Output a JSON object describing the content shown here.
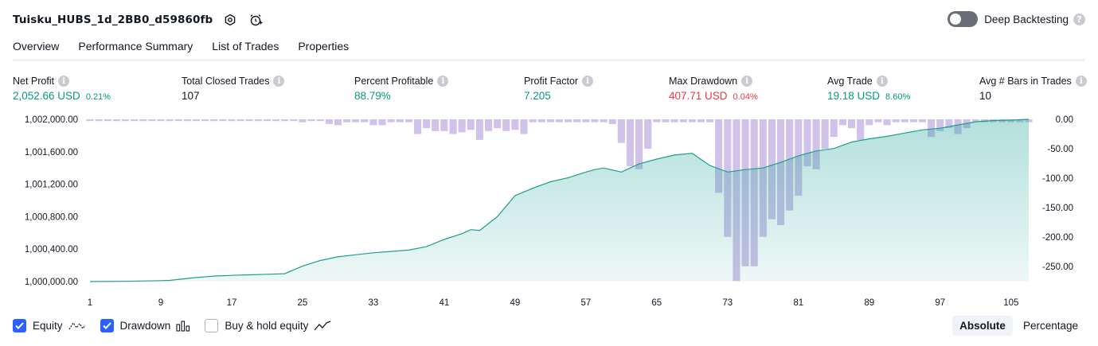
{
  "header": {
    "title": "Tuisku_HUBS_1d_2BB0_d59860fb",
    "deep_label": "Deep Backtesting",
    "deep_enabled": false
  },
  "tabs": [
    {
      "label": "Overview",
      "active": true
    },
    {
      "label": "Performance Summary",
      "active": false
    },
    {
      "label": "List of Trades",
      "active": false
    },
    {
      "label": "Properties",
      "active": false
    }
  ],
  "metrics": [
    {
      "label": "Net Profit",
      "value": "2,052.66 USD",
      "sub": "0.21%",
      "tone": "g"
    },
    {
      "label": "Total Closed Trades",
      "value": "107",
      "sub": "",
      "tone": "k"
    },
    {
      "label": "Percent Profitable",
      "value": "88.79%",
      "sub": "",
      "tone": "g"
    },
    {
      "label": "Profit Factor",
      "value": "7.205",
      "sub": "",
      "tone": "g"
    },
    {
      "label": "Max Drawdown",
      "value": "407.71 USD",
      "sub": "0.04%",
      "tone": "r"
    },
    {
      "label": "Avg Trade",
      "value": "19.18 USD",
      "sub": "8.60%",
      "tone": "g"
    },
    {
      "label": "Avg # Bars in Trades",
      "value": "10",
      "sub": "",
      "tone": "k"
    }
  ],
  "chart_data": {
    "type": "area",
    "x_ticks": [
      "1",
      "9",
      "17",
      "25",
      "33",
      "41",
      "49",
      "57",
      "65",
      "73",
      "81",
      "89",
      "97",
      "105"
    ],
    "left_axis": {
      "ticks": [
        "1,002,000.00",
        "1,001,600.00",
        "1,001,200.00",
        "1,000,800.00",
        "1,000,400.00",
        "1,000,000.00"
      ],
      "range": [
        1000000,
        1002000
      ]
    },
    "right_axis": {
      "ticks": [
        "0.00",
        "-50.00",
        "-100.00",
        "-150.00",
        "-200.00",
        "-250.00"
      ],
      "range": [
        -276,
        0
      ]
    },
    "series": [
      {
        "name": "Equity",
        "color": "#26a69a",
        "points": [
          [
            1,
            1000000
          ],
          [
            5,
            1000003
          ],
          [
            9,
            1000012
          ],
          [
            10,
            1000015
          ],
          [
            13,
            1000050
          ],
          [
            15,
            1000068
          ],
          [
            17,
            1000076
          ],
          [
            19,
            1000083
          ],
          [
            21,
            1000090
          ],
          [
            23,
            1000097
          ],
          [
            25,
            1000190
          ],
          [
            27,
            1000260
          ],
          [
            29,
            1000305
          ],
          [
            31,
            1000330
          ],
          [
            33,
            1000355
          ],
          [
            35,
            1000372
          ],
          [
            37,
            1000388
          ],
          [
            39,
            1000430
          ],
          [
            41,
            1000520
          ],
          [
            43,
            1000590
          ],
          [
            44,
            1000640
          ],
          [
            45,
            1000630
          ],
          [
            47,
            1000800
          ],
          [
            49,
            1001060
          ],
          [
            51,
            1001150
          ],
          [
            53,
            1001230
          ],
          [
            55,
            1001280
          ],
          [
            57,
            1001350
          ],
          [
            58,
            1001380
          ],
          [
            59,
            1001400
          ],
          [
            61,
            1001350
          ],
          [
            63,
            1001450
          ],
          [
            65,
            1001510
          ],
          [
            67,
            1001560
          ],
          [
            69,
            1001580
          ],
          [
            71,
            1001430
          ],
          [
            73,
            1001350
          ],
          [
            75,
            1001380
          ],
          [
            77,
            1001400
          ],
          [
            79,
            1001470
          ],
          [
            81,
            1001550
          ],
          [
            83,
            1001610
          ],
          [
            85,
            1001640
          ],
          [
            87,
            1001720
          ],
          [
            89,
            1001760
          ],
          [
            91,
            1001790
          ],
          [
            93,
            1001830
          ],
          [
            95,
            1001870
          ],
          [
            97,
            1001890
          ],
          [
            99,
            1001930
          ],
          [
            101,
            1001970
          ],
          [
            103,
            1001985
          ],
          [
            105,
            1001990
          ],
          [
            107,
            1002000
          ]
        ]
      },
      {
        "name": "Drawdown",
        "color": "#b39ddb",
        "bars": [
          -3,
          -3,
          -3,
          -3,
          -3,
          -3,
          -3,
          -3,
          -3,
          -3,
          -3,
          -3,
          -3,
          -3,
          -3,
          -3,
          -3,
          -3,
          -3,
          -3,
          -3,
          -3,
          -3,
          -3,
          -5,
          -3,
          -3,
          -8,
          -10,
          -5,
          -5,
          -5,
          -10,
          -10,
          -5,
          -5,
          -5,
          -25,
          -15,
          -20,
          -20,
          -25,
          -22,
          -18,
          -35,
          -20,
          -15,
          -20,
          -18,
          -25,
          -5,
          -5,
          -5,
          -5,
          -5,
          -5,
          -5,
          -5,
          -5,
          -8,
          -40,
          -80,
          -85,
          -50,
          -5,
          -5,
          -5,
          -5,
          -5,
          -5,
          -5,
          -125,
          -200,
          -275,
          -250,
          -250,
          -200,
          -170,
          -180,
          -155,
          -130,
          -80,
          -85,
          -50,
          -30,
          -10,
          -15,
          -35,
          -10,
          -5,
          -10,
          -5,
          -5,
          -5,
          -5,
          -30,
          -20,
          -15,
          -25,
          -15,
          -5,
          -5,
          -5,
          -5,
          -5,
          -5,
          -5
        ]
      }
    ],
    "legend": [
      {
        "label": "Equity",
        "checked": true
      },
      {
        "label": "Drawdown",
        "checked": true
      },
      {
        "label": "Buy & hold equity",
        "checked": false
      }
    ]
  },
  "view_modes": [
    "Absolute",
    "Percentage"
  ],
  "active_view": "Absolute"
}
